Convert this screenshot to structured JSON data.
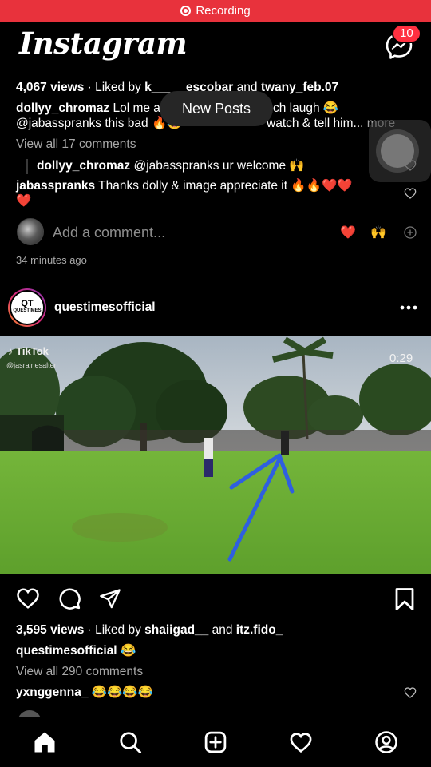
{
  "status_bar": {
    "recording_label": "Recording"
  },
  "header": {
    "logo": "Instagram",
    "messages_badge": "10"
  },
  "post1": {
    "views": "4,067 views",
    "liked_by_prefix": "Liked by",
    "liked_user1": "k_____escobar",
    "liked_and": "and",
    "liked_user2": "twany_feb.07",
    "caption_user": "dollyy_chromaz",
    "caption_line1": "Lol me a",
    "caption_line1_end": "ch laugh 😂",
    "caption_line2_start": "@jabasspranks this bad 🔥😂",
    "caption_line2_end": "watch & tell him...",
    "more": "more",
    "view_comments": "View all 17 comments",
    "reply_user": "dollyy_chromaz",
    "reply_text": "@jabasspranks ur welcome 🙌",
    "comment_user": "jabasspranks",
    "comment_text": "Thanks dolly & image appreciate it 🔥🔥❤️❤️",
    "comment_text_wrap": "❤️",
    "add_comment_placeholder": "Add a comment...",
    "quick_react1": "❤️",
    "quick_react2": "🙌",
    "time": "34 minutes ago"
  },
  "new_posts_pill": "New Posts",
  "post2": {
    "username": "questimesofficial",
    "avatar_text_top": "QT",
    "avatar_text_bottom": "QUESTIMES",
    "video": {
      "watermark": "TikTok",
      "watermark_handle": "@jasrainesalten",
      "timer": "0:29"
    },
    "views": "3,595 views",
    "liked_by_prefix": "Liked by",
    "liked_user1": "shaiigad__",
    "liked_and": "and",
    "liked_user2": "itz.fido_",
    "caption_user": "questimesofficial",
    "caption_text": "😂",
    "view_comments": "View all 290 comments",
    "comment_user": "yxnggenna_",
    "comment_text": "😂😂😂😂"
  },
  "colors": {
    "accent_red": "#ff3040",
    "recording_red": "#e8323c",
    "secondary_text": "#a8a8a8",
    "arrow_blue": "#2f5fe0"
  },
  "icons": [
    "messenger-icon",
    "heart-icon",
    "comment-icon",
    "share-icon",
    "bookmark-icon",
    "more-icon",
    "home-icon",
    "search-icon",
    "create-icon",
    "activity-icon",
    "profile-icon"
  ]
}
